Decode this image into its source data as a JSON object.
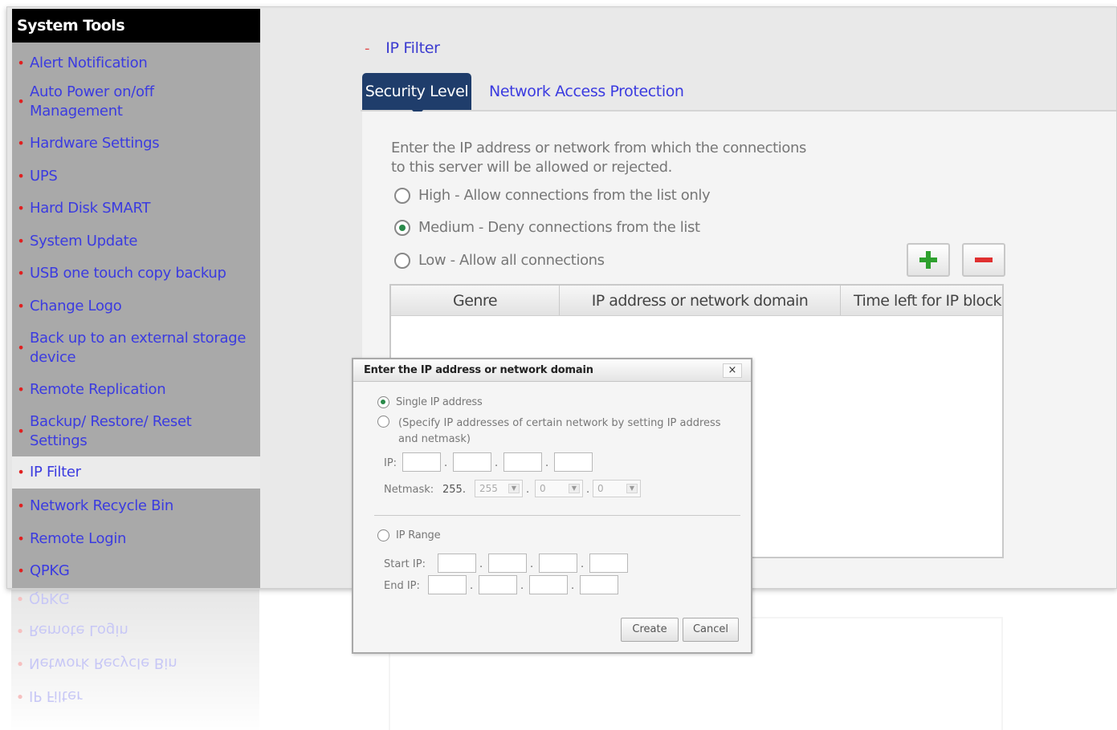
{
  "sidebar": {
    "title": "System Tools",
    "items": [
      {
        "label": "Alert Notification"
      },
      {
        "label": "Auto Power on/off Management"
      },
      {
        "label": "Hardware Settings"
      },
      {
        "label": "UPS"
      },
      {
        "label": "Hard Disk SMART"
      },
      {
        "label": "System Update"
      },
      {
        "label": "USB one touch copy backup"
      },
      {
        "label": "Change Logo"
      },
      {
        "label": "Back up to an external storage device"
      },
      {
        "label": "Remote Replication"
      },
      {
        "label": "Backup/ Restore/ Reset Settings"
      },
      {
        "label": "IP Filter",
        "active": true
      },
      {
        "label": "Network Recycle Bin"
      },
      {
        "label": "Remote Login"
      },
      {
        "label": "QPKG"
      }
    ]
  },
  "section": {
    "collapse_symbol": "-",
    "title": "IP Filter"
  },
  "tabs": [
    {
      "label": "Security Level",
      "active": true
    },
    {
      "label": "Network Access Protection"
    }
  ],
  "security": {
    "description": "Enter the IP address or network from which the connections to this server will be allowed or rejected.",
    "levels": [
      {
        "label": "High - Allow connections from the list only",
        "selected": false
      },
      {
        "label": "Medium - Deny connections from the list",
        "selected": true
      },
      {
        "label": "Low - Allow all connections",
        "selected": false
      }
    ]
  },
  "toolbar": {
    "add_icon": "plus-icon",
    "remove_icon": "minus-icon",
    "add_color": "#2ea02e",
    "remove_color": "#e03030"
  },
  "table": {
    "columns": [
      "Genre",
      "IP address or network domain",
      "Time left for IP blockir"
    ],
    "rows": []
  },
  "dialog": {
    "title": "Enter the IP address or network domain",
    "close_symbol": "×",
    "single_ip": "Single IP address",
    "network_option": "(Specify IP addresses of certain network by setting IP address and netmask)",
    "ip_label": "IP:",
    "netmask_label": "Netmask:",
    "netmask_prefix": "255.",
    "netmask_selects": [
      "255",
      "0",
      "0"
    ],
    "ip_range": "IP Range",
    "start_ip_label": "Start IP:",
    "end_ip_label": "End IP:",
    "create_label": "Create",
    "cancel_label": "Cancel"
  },
  "colors": {
    "sidebar_bg": "#a9a9a9",
    "link_blue": "#3b3be0",
    "tab_active_bg": "#1f3d6b",
    "bullet_red": "#e02020"
  }
}
